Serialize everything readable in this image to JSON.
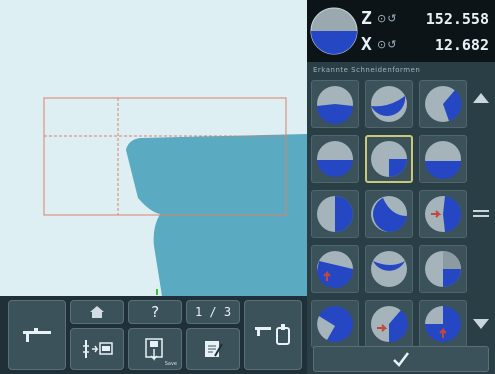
{
  "readout": {
    "z_axis": {
      "letter": "Z",
      "subscript": "⊙↺",
      "value": "152.558"
    },
    "x_axis": {
      "letter": "X",
      "subscript": "⊙↺",
      "value": "12.682"
    }
  },
  "panel": {
    "caption": "Erkannte Schneidenformen",
    "shapes": [
      {
        "variant": "a"
      },
      {
        "variant": "b"
      },
      {
        "variant": "c"
      },
      {
        "variant": "d"
      },
      {
        "variant": "e",
        "selected": true
      },
      {
        "variant": "f"
      },
      {
        "variant": "g"
      },
      {
        "variant": "h"
      },
      {
        "variant": "i"
      },
      {
        "variant": "j"
      },
      {
        "variant": "k"
      },
      {
        "variant": "l"
      },
      {
        "variant": "m"
      },
      {
        "variant": "n"
      },
      {
        "variant": "o"
      }
    ],
    "scroll_up_icon": "triangle-up-icon",
    "scroll_grip_icon": "grip-icon",
    "scroll_down_icon": "triangle-down-icon",
    "confirm_icon": "checkmark-icon"
  },
  "toolbar": {
    "help_label": "?",
    "page_indicator": "1 / 3",
    "save_label": "Save",
    "icons": [
      "caliper-icon",
      "home-icon",
      "measure-transfer-icon",
      "save-icon",
      "edit-icon",
      "tool-measure-icon"
    ]
  },
  "colors": {
    "accent_blue": "#2547c4",
    "tool_fill": "#5aaac2",
    "frame_line": "#d9826b",
    "selection": "#c9c87a"
  }
}
